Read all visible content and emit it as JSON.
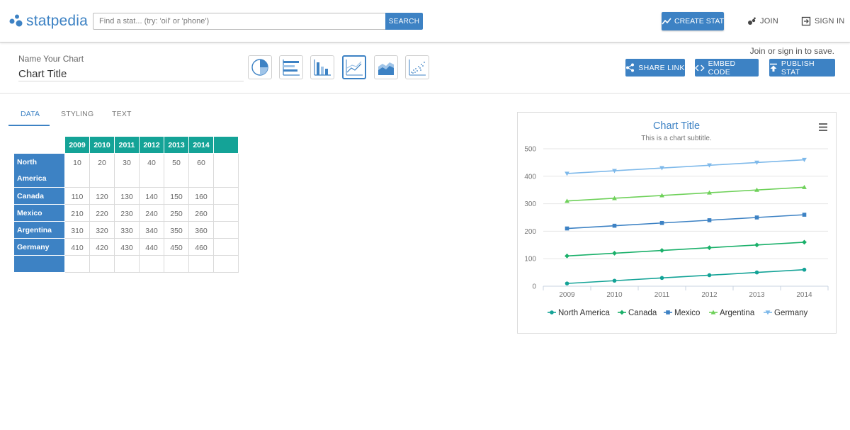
{
  "header": {
    "logo_text": "statpedia",
    "search": {
      "placeholder": "Find a stat... (try: 'oil' or 'phone')",
      "button_label": "SEARCH"
    },
    "create_label": "CREATE STAT",
    "join_label": "JOIN",
    "signin_label": "SIGN IN"
  },
  "editor": {
    "name_label": "Name Your Chart",
    "title_value": "Chart Title",
    "chart_types": [
      "pie",
      "horizontal-bar",
      "column",
      "line",
      "area",
      "scatter"
    ],
    "selected_type": "line",
    "join_note": "Join or sign in to save.",
    "share_label": "SHARE LINK",
    "embed_label": "EMBED CODE",
    "publish_label": "PUBLISH STAT"
  },
  "tabs": [
    {
      "label": "DATA"
    },
    {
      "label": "STYLING"
    },
    {
      "label": "TEXT"
    }
  ],
  "table": {
    "columns": [
      "2009",
      "2010",
      "2011",
      "2012",
      "2013",
      "2014"
    ],
    "rows": [
      {
        "name": "North America",
        "values": [
          "10",
          "20",
          "30",
          "40",
          "50",
          "60"
        ]
      },
      {
        "name": "Canada",
        "values": [
          "110",
          "120",
          "130",
          "140",
          "150",
          "160"
        ]
      },
      {
        "name": "Mexico",
        "values": [
          "210",
          "220",
          "230",
          "240",
          "250",
          "260"
        ]
      },
      {
        "name": "Argentina",
        "values": [
          "310",
          "320",
          "330",
          "340",
          "350",
          "360"
        ]
      },
      {
        "name": "Germany",
        "values": [
          "410",
          "420",
          "430",
          "440",
          "450",
          "460"
        ]
      }
    ]
  },
  "colors": {
    "primary": "#3d82c4",
    "table_header": "#14a397"
  },
  "chart_data": {
    "type": "line",
    "title": "Chart Title",
    "subtitle": "This is a chart subtitle.",
    "xlabel": "",
    "ylabel": "",
    "categories": [
      "2009",
      "2010",
      "2011",
      "2012",
      "2013",
      "2014"
    ],
    "ylim": [
      0,
      500
    ],
    "yticks": [
      "0",
      "100",
      "200",
      "300",
      "400",
      "500"
    ],
    "grid": true,
    "legend_position": "bottom",
    "series": [
      {
        "name": "North America",
        "values": [
          10,
          20,
          30,
          40,
          50,
          60
        ],
        "color": "#14a397",
        "marker": "circle"
      },
      {
        "name": "Canada",
        "values": [
          110,
          120,
          130,
          140,
          150,
          160
        ],
        "color": "#1ab06a",
        "marker": "diamond"
      },
      {
        "name": "Mexico",
        "values": [
          210,
          220,
          230,
          240,
          250,
          260
        ],
        "color": "#3d82c4",
        "marker": "square"
      },
      {
        "name": "Argentina",
        "values": [
          310,
          320,
          330,
          340,
          350,
          360
        ],
        "color": "#6fd15a",
        "marker": "triangle"
      },
      {
        "name": "Germany",
        "values": [
          410,
          420,
          430,
          440,
          450,
          460
        ],
        "color": "#7eb9ea",
        "marker": "triangle-down"
      }
    ]
  }
}
